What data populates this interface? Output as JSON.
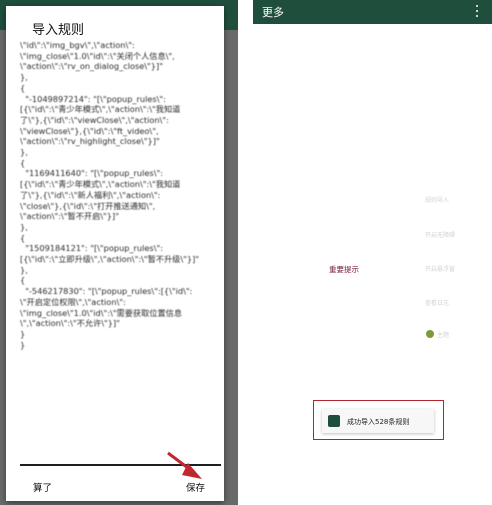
{
  "left": {
    "dialog": {
      "title": "导入规则",
      "code_lines": [
        "\\\"id\\\":\\\"img_bgv\\\",\\\"action\\\":",
        "\\\"img_close\\\"1.0\\\"id\\\":\\\"关闭个人信息\\\",",
        "\\\"action\\\":\\\"rv_on_dialog_close\\\"}]\"",
        "},",
        "{",
        "  \"-1049897214\": \"[\\\"popup_rules\\\":",
        "[{\\\"id\\\":\\\"青少年模式\\\",\\\"action\\\":\\\"我知道",
        "了\\\"},{\\\"id\\\":\\\"viewClose\\\",\\\"action\\\":",
        "\\\"viewClose\\\"},{\\\"id\\\":\\\"ft_video\\\",",
        "\\\"action\\\":\\\"rv_highlight_close\\\"}]\"",
        "},",
        "{",
        "  \"1169411640\": \"[\\\"popup_rules\\\":",
        "[{\\\"id\\\":\\\"青少年模式\\\",\\\"action\\\":\\\"我知道",
        "了\\\"},{\\\"id\\\":\\\"新人福利\\\",\\\"action\\\":",
        "\\\"close\\\"},{\\\"id\\\":\\\"打开推送通知\\\",",
        "\\\"action\\\":\\\"暂不开启\\\"}]\"",
        "},",
        "{",
        "  \"1509184121\": \"[\\\"popup_rules\\\":",
        "[{\\\"id\\\":\\\"立即升级\\\",\\\"action\\\":\\\"暂不升级\\\"}]\"",
        "},",
        "{",
        "  \"-546217830\": \"[\\\"popup_rules\\\":[{\\\"id\\\":",
        "\\\"开启定位权限\\\",\\\"action\\\":",
        "\\\"img_close\\\"1.0\\\"id\\\":\\\"需要获取位置信息",
        "\\\",\\\"action\\\":\\\"不允许\\\"}]\"",
        "}",
        "}"
      ],
      "cancel_label": "算了",
      "save_label": "保存"
    }
  },
  "right": {
    "appbar_title": "更多",
    "center_link": "重要提示",
    "faint_items": [
      "规则导入",
      "开启无障碍",
      "开启悬浮窗",
      "查看日志"
    ],
    "faint_item_last": "主题",
    "toast_text": "成功导入528条规则",
    "colors": {
      "appbar": "#1f4f3c",
      "link": "#7a1f36",
      "highlight_box": "#b3242c",
      "arrow": "#c0282f"
    }
  }
}
